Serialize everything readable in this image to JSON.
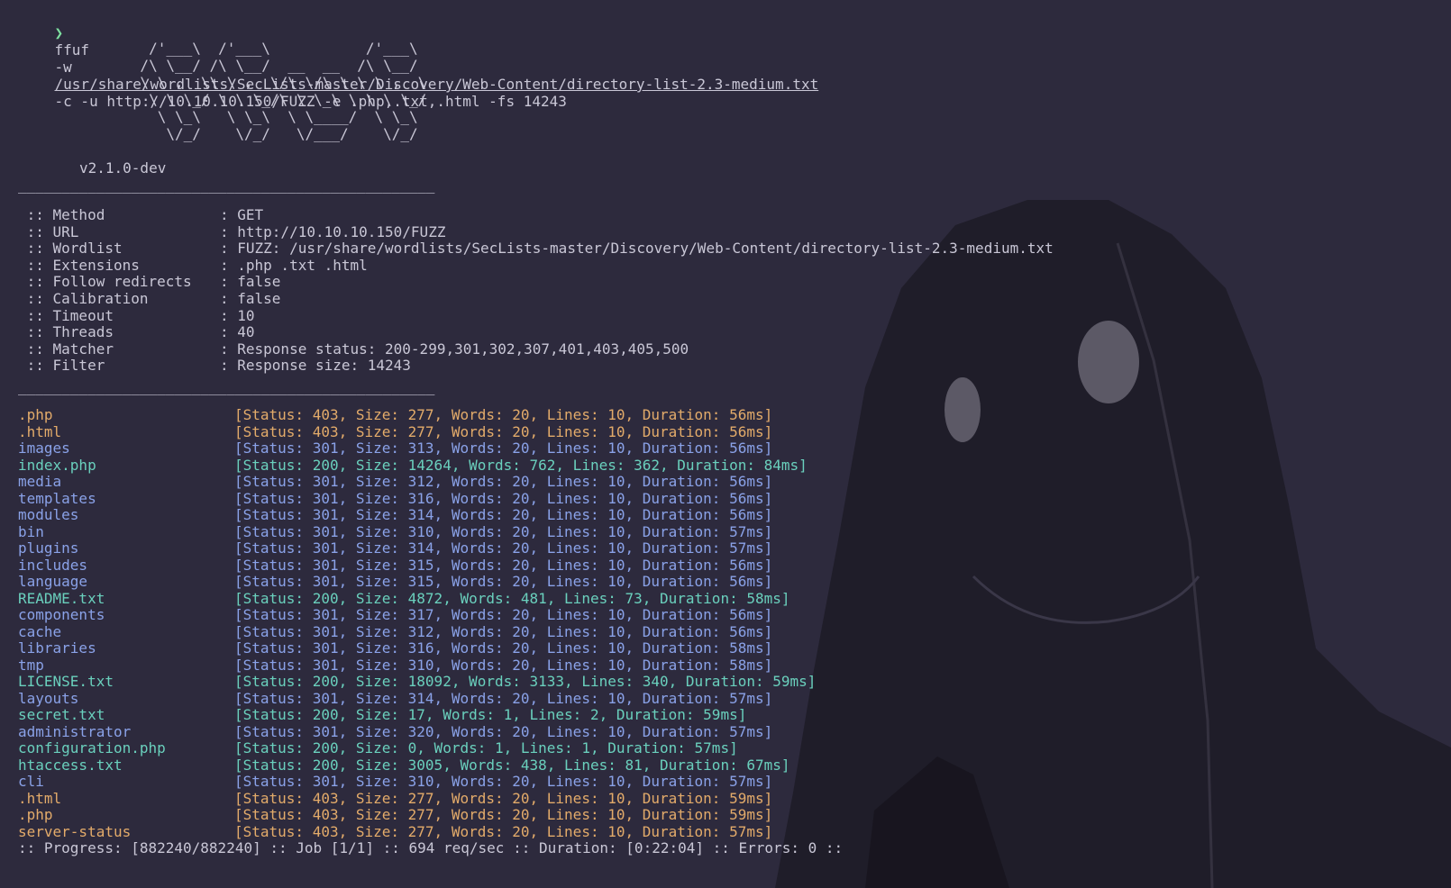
{
  "command": {
    "prompt": "❯",
    "binary": "ffuf",
    "flag_wordlist": "-w",
    "wordlist_path": "/usr/share/wordlists/SecLists-master/Discovery/Web-Content/directory-list-2.3-medium.txt",
    "rest": "-c -u http://10.10.10.150/FUZZ -e .php,.txt,.html -fs 14243"
  },
  "banner": {
    "ascii": "        /'___\\  /'___\\           /'___\\       \n       /\\ \\__/ /\\ \\__/  __  __  /\\ \\__/       \n       \\ \\ ,__\\\\ \\ ,__\\/\\ \\/\\ \\ \\ \\ ,__\\      \n        \\ \\ \\_/ \\ \\ \\_/\\ \\ \\_\\ \\ \\ \\ \\_/      \n         \\ \\_\\   \\ \\_\\  \\ \\____/  \\ \\_\\       \n          \\/_/    \\/_/   \\/___/    \\/_/       ",
    "version": "v2.1.0-dev",
    "divider": "________________________________________________"
  },
  "config": [
    {
      "key": " :: Method",
      "value": ": GET"
    },
    {
      "key": " :: URL",
      "value": ": http://10.10.10.150/FUZZ"
    },
    {
      "key": " :: Wordlist",
      "value": ": FUZZ: /usr/share/wordlists/SecLists-master/Discovery/Web-Content/directory-list-2.3-medium.txt"
    },
    {
      "key": " :: Extensions",
      "value": ": .php .txt .html"
    },
    {
      "key": " :: Follow redirects",
      "value": ": false"
    },
    {
      "key": " :: Calibration",
      "value": ": false"
    },
    {
      "key": " :: Timeout",
      "value": ": 10"
    },
    {
      "key": " :: Threads",
      "value": ": 40"
    },
    {
      "key": " :: Matcher",
      "value": ": Response status: 200-299,301,302,307,401,403,405,500"
    },
    {
      "key": " :: Filter",
      "value": ": Response size: 14243"
    }
  ],
  "results": [
    {
      "name": ".php",
      "status": 403,
      "info": "[Status: 403, Size: 277, Words: 20, Lines: 10, Duration: 56ms]"
    },
    {
      "name": ".html",
      "status": 403,
      "info": "[Status: 403, Size: 277, Words: 20, Lines: 10, Duration: 56ms]"
    },
    {
      "name": "images",
      "status": 301,
      "info": "[Status: 301, Size: 313, Words: 20, Lines: 10, Duration: 56ms]"
    },
    {
      "name": "index.php",
      "status": 200,
      "info": "[Status: 200, Size: 14264, Words: 762, Lines: 362, Duration: 84ms]"
    },
    {
      "name": "media",
      "status": 301,
      "info": "[Status: 301, Size: 312, Words: 20, Lines: 10, Duration: 56ms]"
    },
    {
      "name": "templates",
      "status": 301,
      "info": "[Status: 301, Size: 316, Words: 20, Lines: 10, Duration: 56ms]"
    },
    {
      "name": "modules",
      "status": 301,
      "info": "[Status: 301, Size: 314, Words: 20, Lines: 10, Duration: 56ms]"
    },
    {
      "name": "bin",
      "status": 301,
      "info": "[Status: 301, Size: 310, Words: 20, Lines: 10, Duration: 57ms]"
    },
    {
      "name": "plugins",
      "status": 301,
      "info": "[Status: 301, Size: 314, Words: 20, Lines: 10, Duration: 57ms]"
    },
    {
      "name": "includes",
      "status": 301,
      "info": "[Status: 301, Size: 315, Words: 20, Lines: 10, Duration: 56ms]"
    },
    {
      "name": "language",
      "status": 301,
      "info": "[Status: 301, Size: 315, Words: 20, Lines: 10, Duration: 56ms]"
    },
    {
      "name": "README.txt",
      "status": 200,
      "info": "[Status: 200, Size: 4872, Words: 481, Lines: 73, Duration: 58ms]"
    },
    {
      "name": "components",
      "status": 301,
      "info": "[Status: 301, Size: 317, Words: 20, Lines: 10, Duration: 56ms]"
    },
    {
      "name": "cache",
      "status": 301,
      "info": "[Status: 301, Size: 312, Words: 20, Lines: 10, Duration: 56ms]"
    },
    {
      "name": "libraries",
      "status": 301,
      "info": "[Status: 301, Size: 316, Words: 20, Lines: 10, Duration: 58ms]"
    },
    {
      "name": "tmp",
      "status": 301,
      "info": "[Status: 301, Size: 310, Words: 20, Lines: 10, Duration: 58ms]"
    },
    {
      "name": "LICENSE.txt",
      "status": 200,
      "info": "[Status: 200, Size: 18092, Words: 3133, Lines: 340, Duration: 59ms]"
    },
    {
      "name": "layouts",
      "status": 301,
      "info": "[Status: 301, Size: 314, Words: 20, Lines: 10, Duration: 57ms]"
    },
    {
      "name": "secret.txt",
      "status": 200,
      "info": "[Status: 200, Size: 17, Words: 1, Lines: 2, Duration: 59ms]"
    },
    {
      "name": "administrator",
      "status": 301,
      "info": "[Status: 301, Size: 320, Words: 20, Lines: 10, Duration: 57ms]"
    },
    {
      "name": "configuration.php",
      "status": 200,
      "info": "[Status: 200, Size: 0, Words: 1, Lines: 1, Duration: 57ms]"
    },
    {
      "name": "htaccess.txt",
      "status": 200,
      "info": "[Status: 200, Size: 3005, Words: 438, Lines: 81, Duration: 67ms]"
    },
    {
      "name": "cli",
      "status": 301,
      "info": "[Status: 301, Size: 310, Words: 20, Lines: 10, Duration: 57ms]"
    },
    {
      "name": ".html",
      "status": 403,
      "info": "[Status: 403, Size: 277, Words: 20, Lines: 10, Duration: 59ms]"
    },
    {
      "name": ".php",
      "status": 403,
      "info": "[Status: 403, Size: 277, Words: 20, Lines: 10, Duration: 59ms]"
    },
    {
      "name": "server-status",
      "status": 403,
      "info": "[Status: 403, Size: 277, Words: 20, Lines: 10, Duration: 57ms]"
    }
  ],
  "progress": ":: Progress: [882240/882240] :: Job [1/1] :: 694 req/sec :: Duration: [0:22:04] :: Errors: 0 ::",
  "colors": {
    "background": "#2d2a3d",
    "text": "#c9c7d6",
    "prompt": "#7ee0a0",
    "status_200": "#6ad0bd",
    "status_301": "#8aa2e8",
    "status_403": "#e3ab6a"
  },
  "icons": {
    "prompt": "prompt-chevron-icon",
    "background": "hooded-figure-icon"
  }
}
